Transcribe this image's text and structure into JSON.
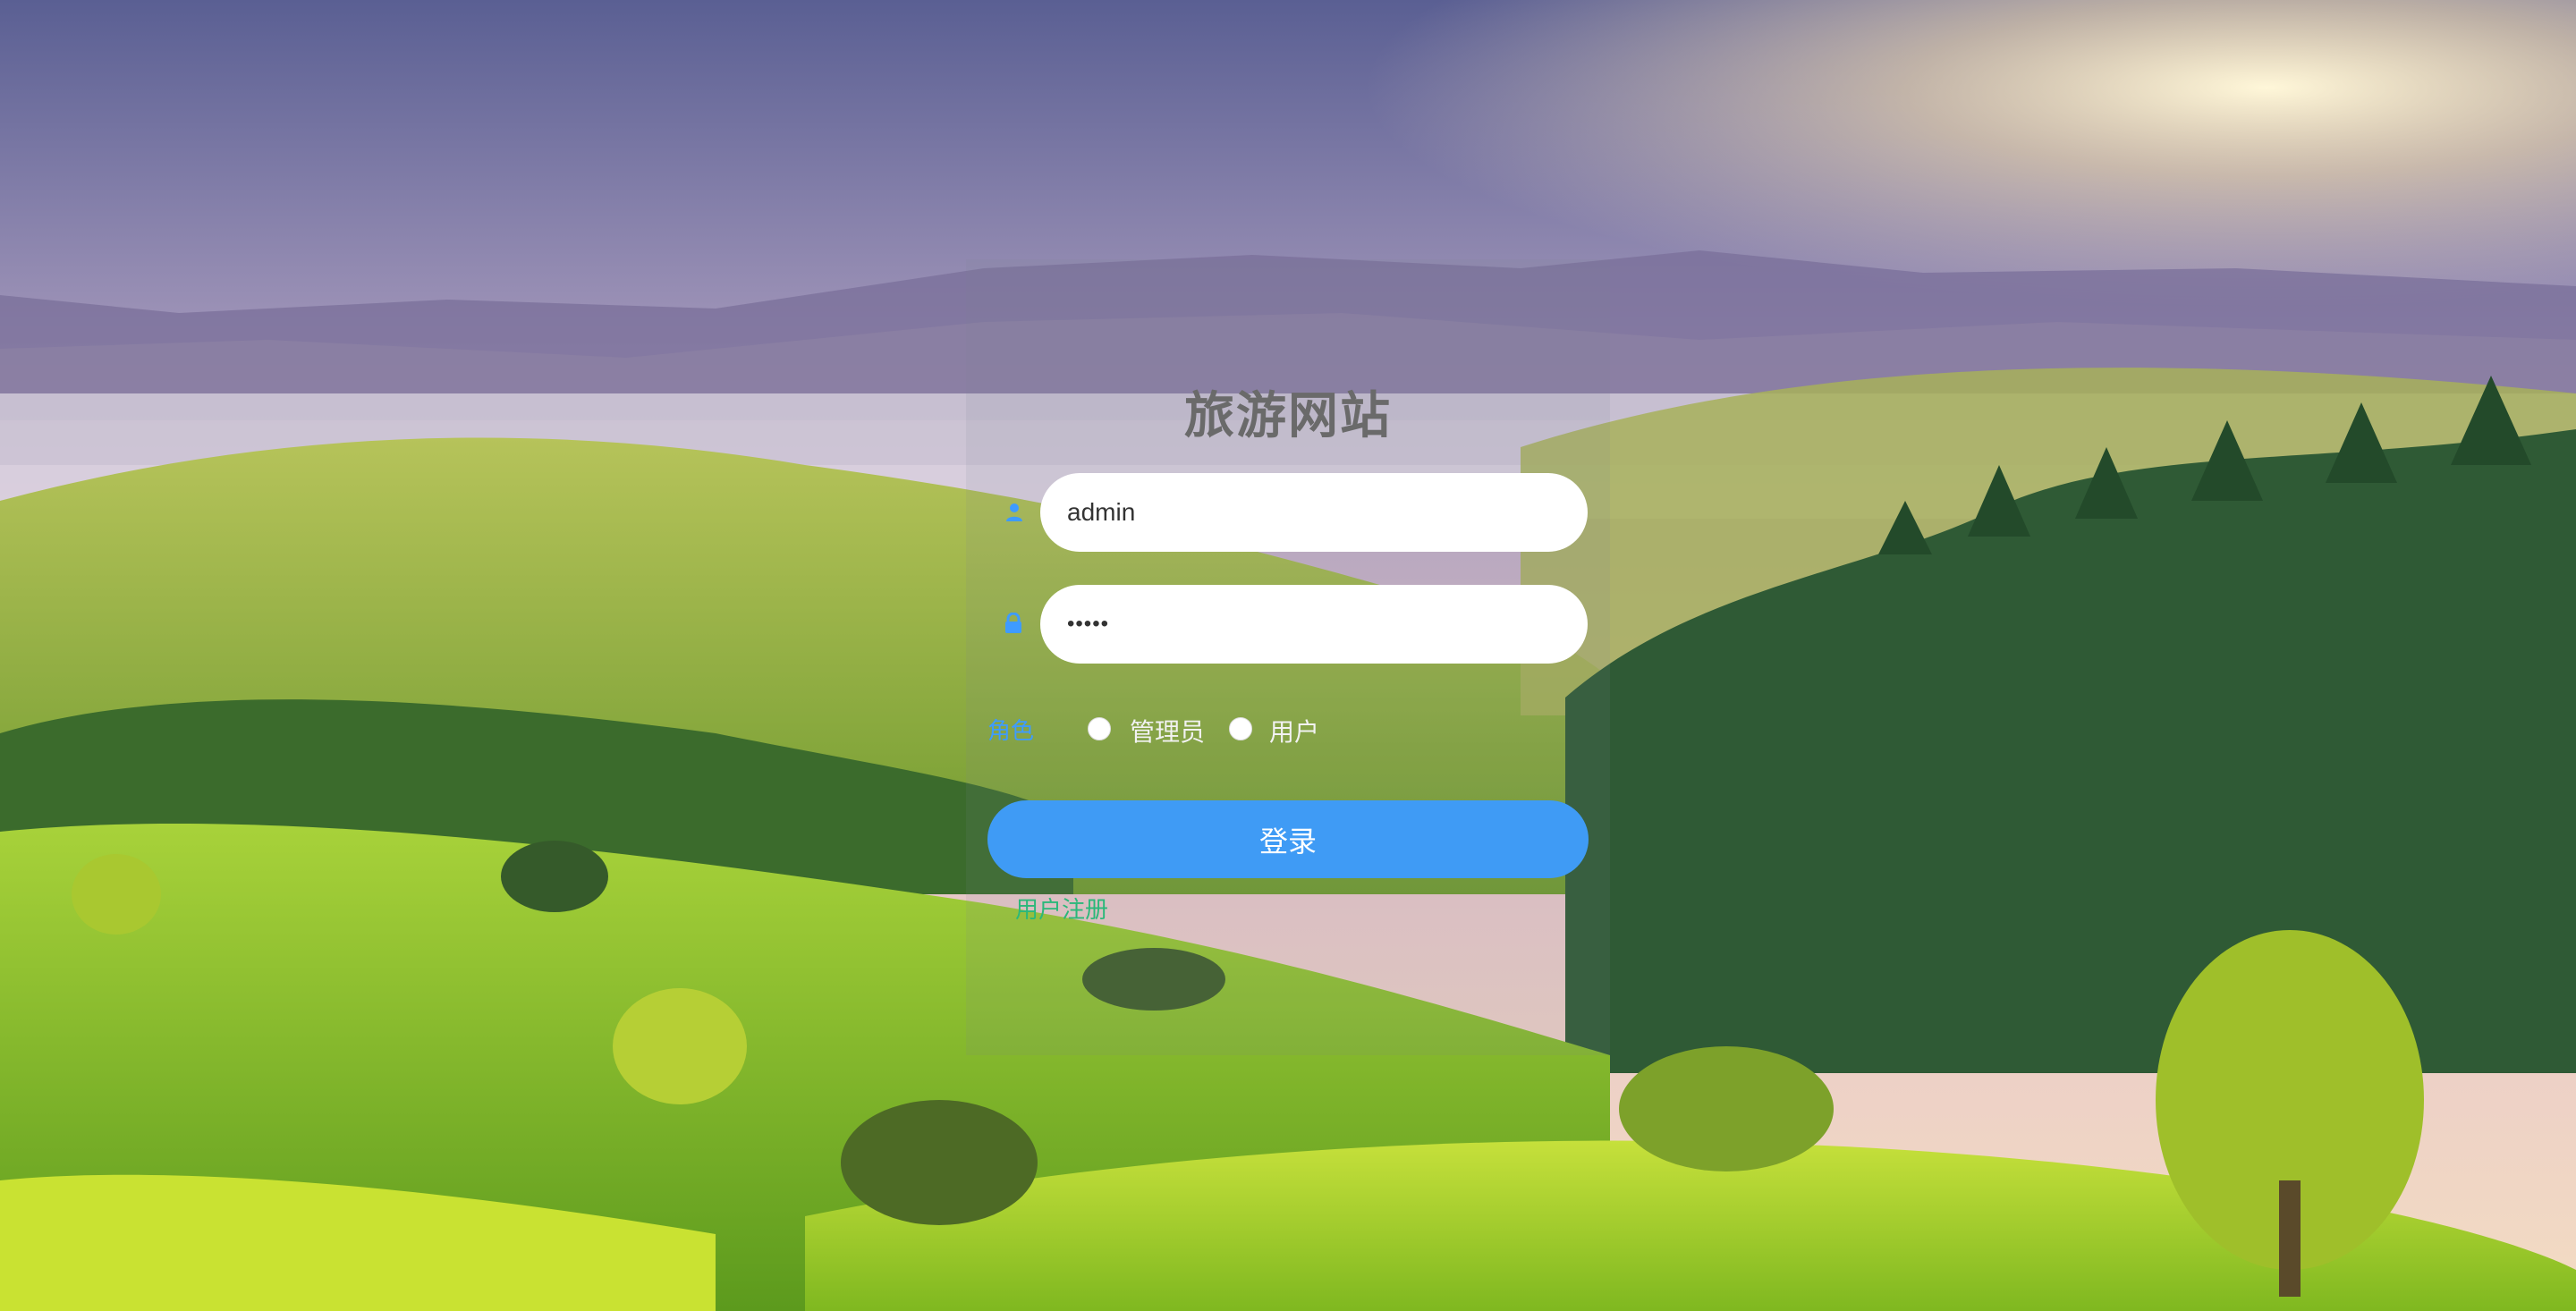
{
  "site_title": "旅游网站",
  "login_form": {
    "username_value": "admin",
    "password_value": "•••••",
    "role_label": "角色",
    "role_options": [
      "管理员",
      "用户"
    ],
    "login_button": "登录",
    "register_link": "用户注册"
  },
  "colors": {
    "accent": "#3f9bf5",
    "register_link": "#2bb87a",
    "title": "#6a6a6a"
  },
  "icons": {
    "username": "user-icon",
    "password": "lock-icon"
  }
}
